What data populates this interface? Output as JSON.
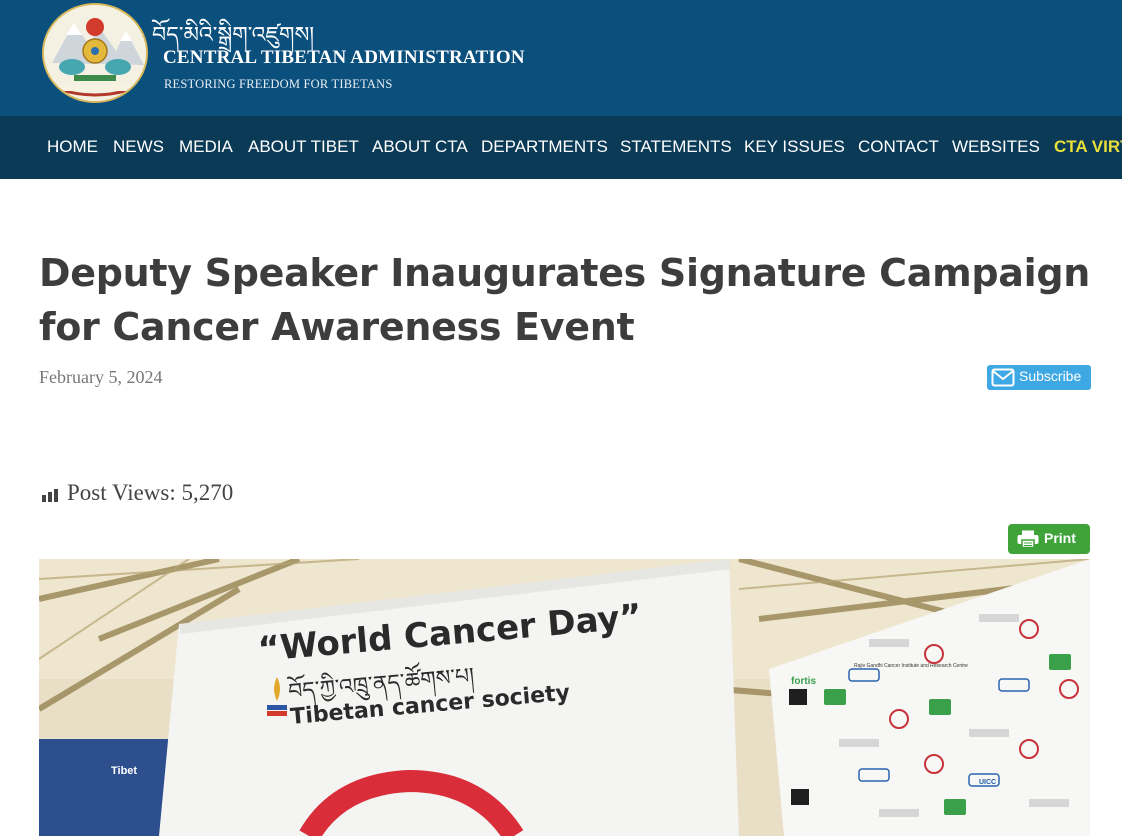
{
  "header": {
    "tibetan_name": "བོད་མིའི་སྒྲིག་འཛུགས།",
    "org_name": "CENTRAL TIBETAN ADMINISTRATION",
    "tagline": "RESTORING FREEDOM FOR TIBETANS",
    "colors": {
      "header_bg": "#0b4f7d",
      "nav_bg": "#0b3a57",
      "highlight": "#e8df3a"
    }
  },
  "nav": {
    "items": [
      {
        "label": "HOME"
      },
      {
        "label": "NEWS"
      },
      {
        "label": "MEDIA"
      },
      {
        "label": "ABOUT TIBET"
      },
      {
        "label": "ABOUT CTA"
      },
      {
        "label": "DEPARTMENTS"
      },
      {
        "label": "STATEMENTS"
      },
      {
        "label": "KEY ISSUES"
      },
      {
        "label": "CONTACT"
      },
      {
        "label": "WEBSITES"
      },
      {
        "label": "CTA VIRT"
      }
    ]
  },
  "article": {
    "title": "Deputy Speaker Inaugurates Signature Campaign for Cancer Awareness Event",
    "date": "February 5, 2024",
    "subscribe_label": "Subscribe",
    "views_label": "Post Views: 5,270",
    "print_label": "Print"
  },
  "photo": {
    "banner_main": "“World Cancer Day”",
    "banner_tibetan": "བོད་ཀྱི་འཁྲུ་ནད་ཚོགས་པ།",
    "banner_society": "Tibetan cancer society",
    "backdrop_logo": "fortis",
    "backdrop_text": "Rajiv Gandhi Cancer Institute and Research Centre",
    "backdrop_badge": "UICC",
    "left_banner_text": "Tibet"
  }
}
